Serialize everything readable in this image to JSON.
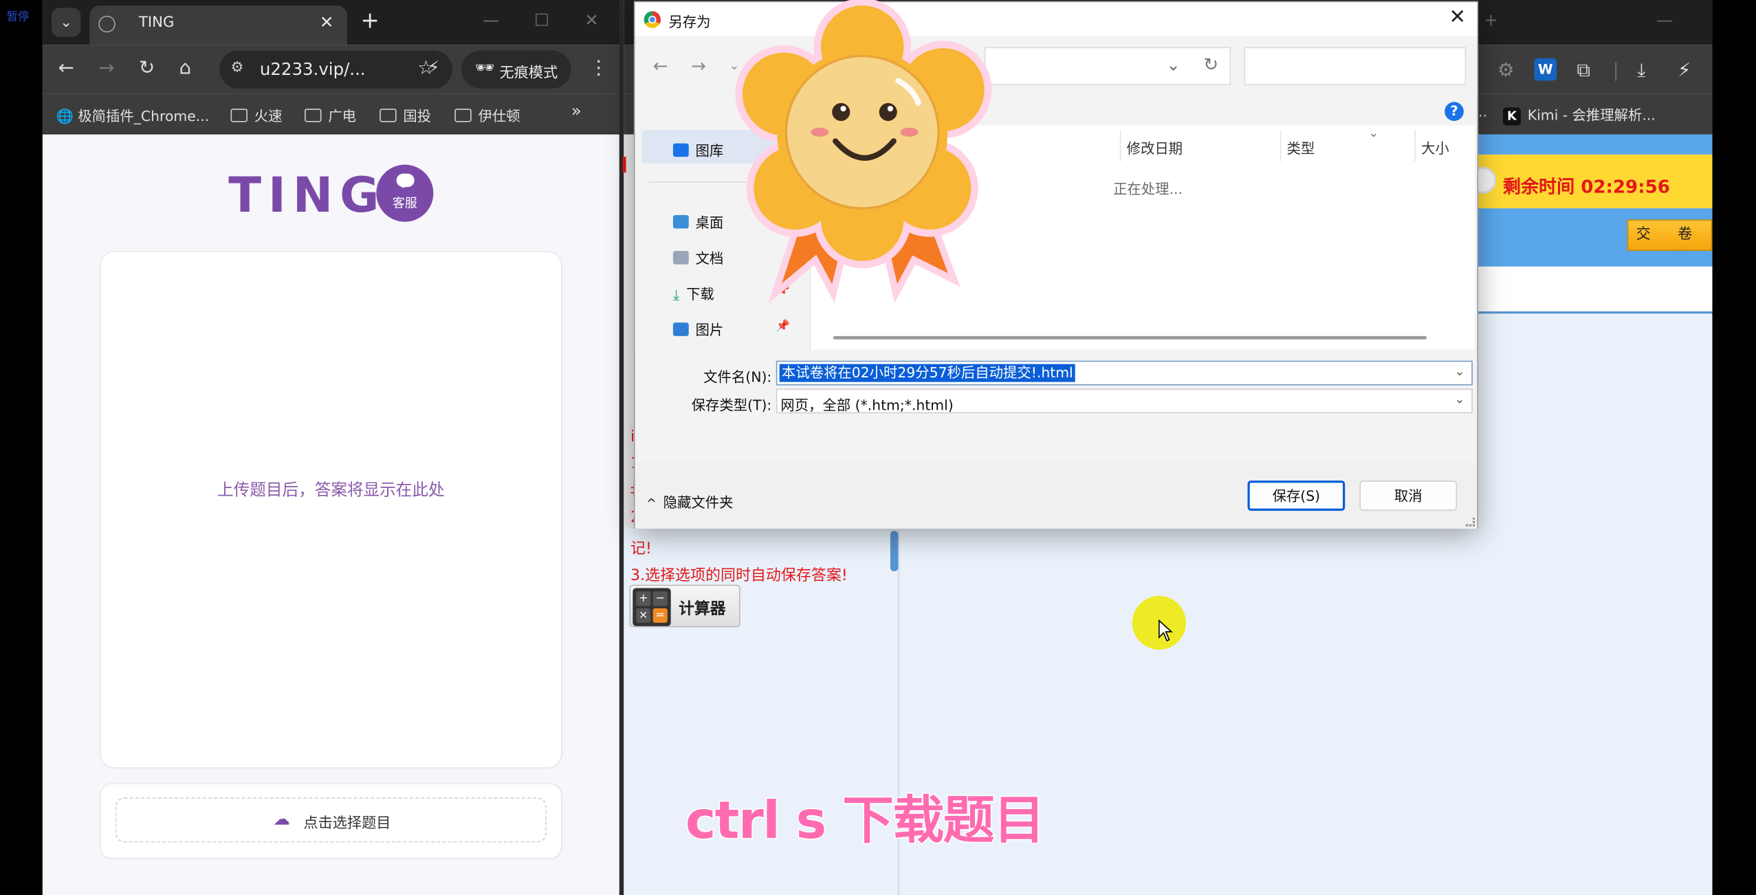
{
  "overlay": {
    "pause_label": "暂停",
    "caption": "ctrl s 下载题目"
  },
  "left_browser": {
    "tab_title": "TING",
    "url": "u2233.vip/...",
    "incognito_label": "无痕模式",
    "bookmarks": [
      "极简插件_Chrome...",
      "火速",
      "广电",
      "国投",
      "伊仕顿"
    ],
    "page": {
      "logo": "TING",
      "service_label": "客服",
      "answer_placeholder": "上传题目后，答案将显示在此处",
      "upload_label": "点击选择题目"
    }
  },
  "right_browser": {
    "bookmark_kimi": "Kimi - 会推理解析...",
    "timer_text": "剩余时间 02:29:56",
    "submit_label": "交 卷",
    "notices": [
      "3.选择选项的同时自动保存答案!"
    ],
    "notice_fragments": [
      "i",
      "1",
      "‡",
      "2",
      "记!"
    ],
    "calculator_label": "计算器"
  },
  "save_dialog": {
    "title": "另存为",
    "nav_items": [
      {
        "label": "图库",
        "color": "#1a73e8"
      },
      {
        "label": "桌面",
        "color": "#3a8fd8"
      },
      {
        "label": "文档",
        "color": "#9aa6b8"
      },
      {
        "label": "下载",
        "color": "#1aa260"
      },
      {
        "label": "图片",
        "color": "#2f7fd6"
      }
    ],
    "columns": [
      "修改日期",
      "类型",
      "大小"
    ],
    "processing_text": "正在处理...",
    "filename_label": "文件名(N):",
    "filename_value": "本试卷将在02小时29分57秒后自动提交!.html",
    "filetype_label": "保存类型(T):",
    "filetype_value": "网页，全部 (*.htm;*.html)",
    "hide_folders_label": "隐藏文件夹",
    "save_button": "保存(S)",
    "cancel_button": "取消"
  },
  "colors": {
    "brand_purple": "#7b4aa8",
    "timer_red": "#e31818",
    "dialog_accent": "#0a5ed7",
    "caption_pink": "#ff6bb0"
  }
}
